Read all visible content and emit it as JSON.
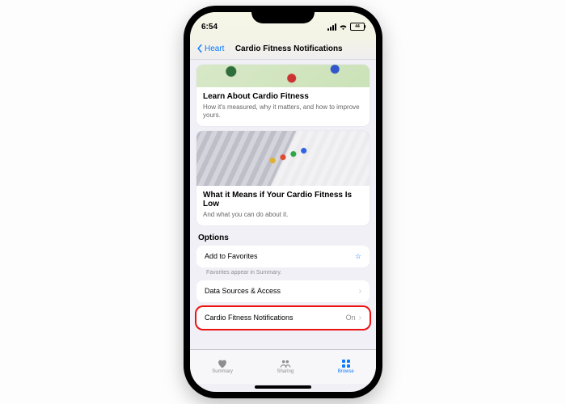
{
  "status": {
    "time": "6:54",
    "battery": "44"
  },
  "nav": {
    "back": "Heart",
    "title": "Cardio Fitness Notifications"
  },
  "cards": {
    "learn": {
      "title": "Learn About Cardio Fitness",
      "subtitle": "How it's measured, why it matters, and how to improve yours."
    },
    "low": {
      "title": "What it Means if Your Cardio Fitness Is Low",
      "subtitle": "And what you can do about it."
    }
  },
  "options": {
    "heading": "Options",
    "favorites": "Add to Favorites",
    "favoritesHint": "Favorites appear in Summary.",
    "dataSources": "Data Sources & Access",
    "notifications": {
      "label": "Cardio Fitness Notifications",
      "value": "On"
    }
  },
  "tabs": {
    "summary": "Summary",
    "sharing": "Sharing",
    "browse": "Browse"
  }
}
